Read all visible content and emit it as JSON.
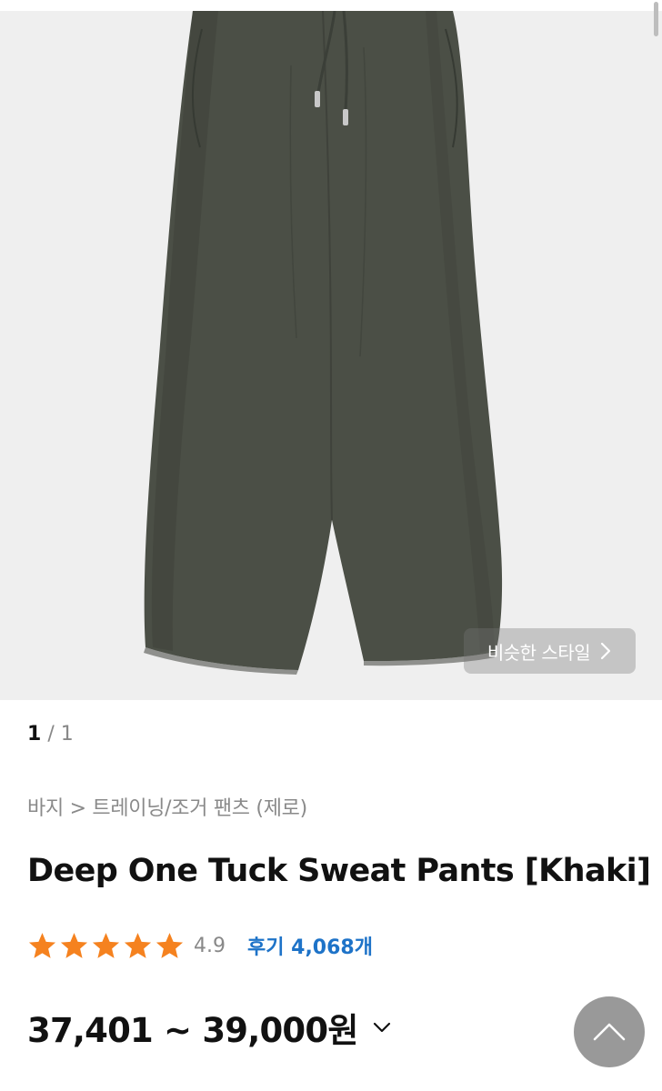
{
  "hero": {
    "image_alt": "Deep One Tuck Sweat Pants Khaki product photo",
    "similar_style_label": "비슷한 스타일"
  },
  "gallery": {
    "current": "1",
    "separator": "/",
    "total": "1"
  },
  "breadcrumb": {
    "text": "바지 > 트레이닝/조거 팬츠 (제로)"
  },
  "product": {
    "title": "Deep One Tuck Sweat Pants [Khaki]",
    "rating": "4.9",
    "rating_stars": 5,
    "reviews_label": "후기 4,068개",
    "price": "37,401 ~ 39,000원"
  },
  "colors": {
    "star": "#f5821f",
    "review_link": "#1e73c8",
    "pants": "#4b4f46"
  },
  "icons": {
    "similar": "chevron-right-icon",
    "price": "chevron-down-icon",
    "top": "chevron-up-icon"
  }
}
